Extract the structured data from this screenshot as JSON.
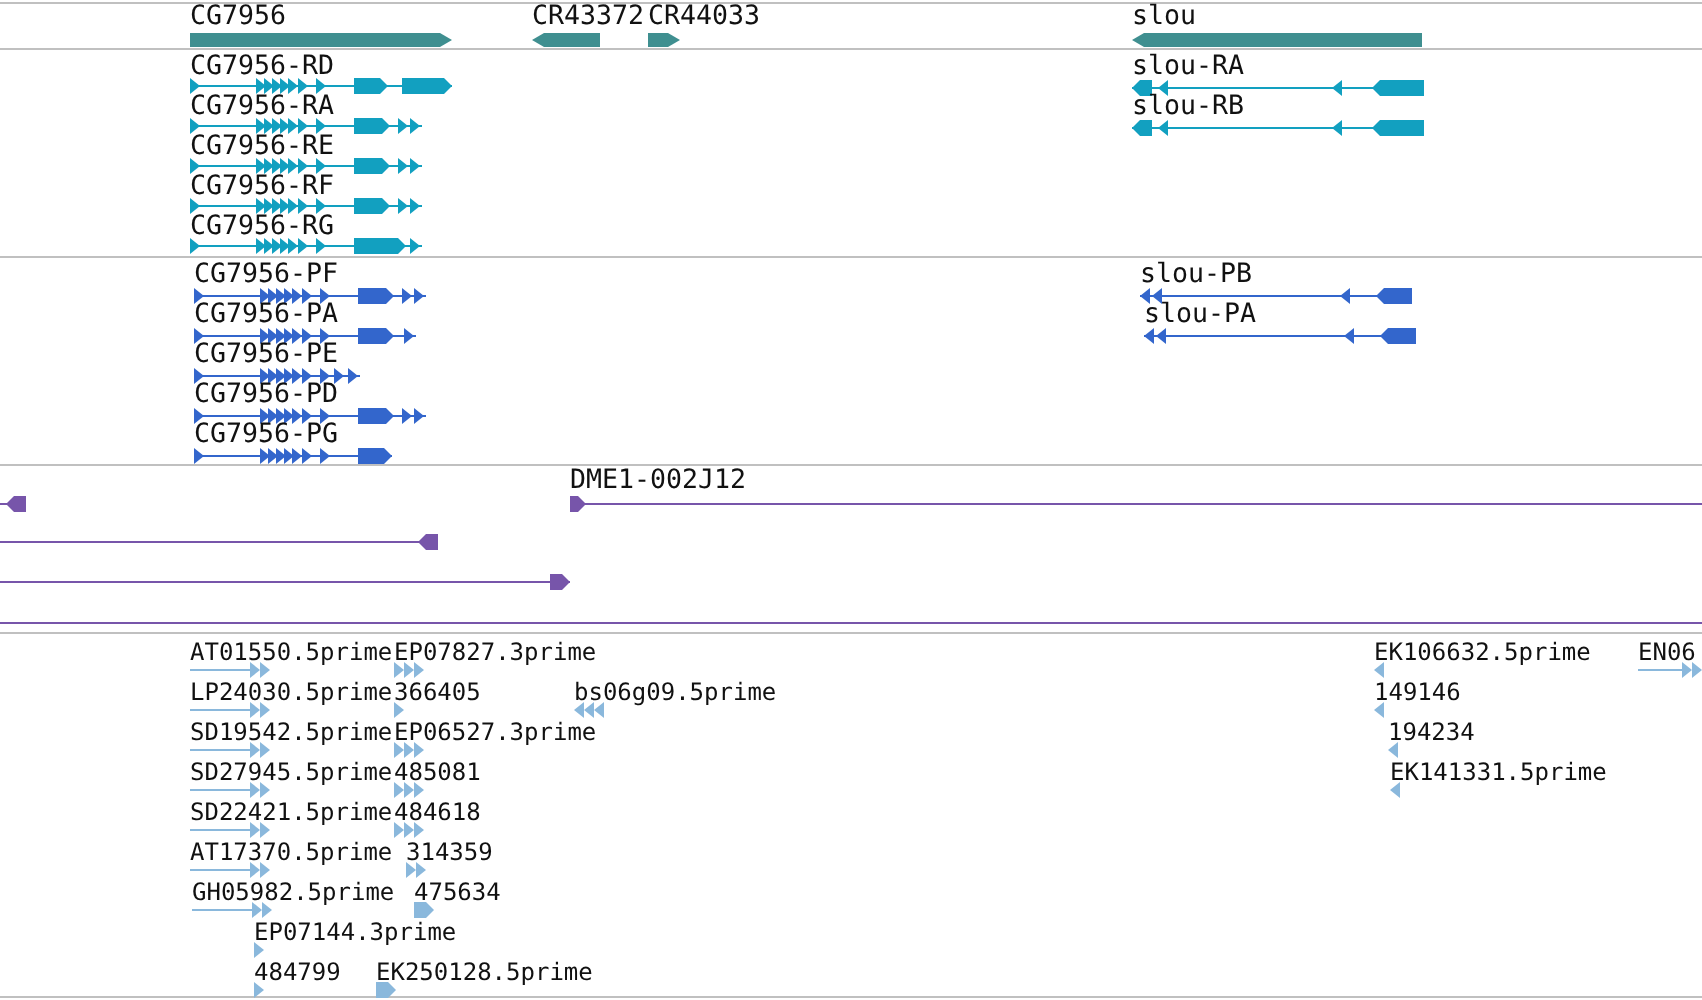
{
  "tracks": [
    {
      "kind": "gene",
      "features": [
        {
          "label": "CG7956",
          "reverse": false
        },
        {
          "label": "CR43372",
          "reverse": true
        },
        {
          "label": "CR44033",
          "reverse": false
        },
        {
          "label": "slou",
          "reverse": true
        }
      ]
    },
    {
      "kind": "transcript",
      "features": [
        {
          "label": "CG7956-RD",
          "reverse": false
        },
        {
          "label": "CG7956-RA",
          "reverse": false
        },
        {
          "label": "CG7956-RE",
          "reverse": false
        },
        {
          "label": "CG7956-RF",
          "reverse": false
        },
        {
          "label": "CG7956-RG",
          "reverse": false
        },
        {
          "label": "slou-RA",
          "reverse": true
        },
        {
          "label": "slou-RB",
          "reverse": true
        }
      ]
    },
    {
      "kind": "protein",
      "features": [
        {
          "label": "CG7956-PF",
          "reverse": false
        },
        {
          "label": "CG7956-PA",
          "reverse": false
        },
        {
          "label": "CG7956-PE",
          "reverse": false
        },
        {
          "label": "CG7956-PD",
          "reverse": false
        },
        {
          "label": "CG7956-PG",
          "reverse": false
        },
        {
          "label": "slou-PB",
          "reverse": true
        },
        {
          "label": "slou-PA",
          "reverse": true
        }
      ]
    },
    {
      "kind": "clone",
      "features": [
        {
          "reverse": true
        },
        {
          "label": "DME1-002J12",
          "reverse": false
        },
        {
          "reverse": true
        },
        {
          "reverse": false
        }
      ]
    },
    {
      "kind": "est",
      "features": [
        {
          "label": "AT01550.5prime",
          "reverse": false
        },
        {
          "label": "EP07827.3prime",
          "reverse": false
        },
        {
          "label": "EK106632.5prime",
          "reverse": true
        },
        {
          "label": "EN06",
          "reverse": false
        },
        {
          "label": "LP24030.5prime",
          "reverse": false
        },
        {
          "label": "366405",
          "reverse": false
        },
        {
          "label": "bs06g09.5prime",
          "reverse": true
        },
        {
          "label": "149146",
          "reverse": true
        },
        {
          "label": "SD19542.5prime",
          "reverse": false
        },
        {
          "label": "EP06527.3prime",
          "reverse": false
        },
        {
          "label": "194234",
          "reverse": true
        },
        {
          "label": "SD27945.5prime",
          "reverse": false
        },
        {
          "label": "485081",
          "reverse": false
        },
        {
          "label": "EK141331.5prime",
          "reverse": true
        },
        {
          "label": "SD22421.5prime",
          "reverse": false
        },
        {
          "label": "484618",
          "reverse": false
        },
        {
          "label": "AT17370.5prime",
          "reverse": false
        },
        {
          "label": "314359",
          "reverse": false
        },
        {
          "label": "GH05982.5prime",
          "reverse": false
        },
        {
          "label": "475634",
          "reverse": false
        },
        {
          "label": "EP07144.3prime",
          "reverse": false
        },
        {
          "label": "484799",
          "reverse": false
        },
        {
          "label": "EK250128.5prime",
          "reverse": false
        }
      ]
    }
  ]
}
